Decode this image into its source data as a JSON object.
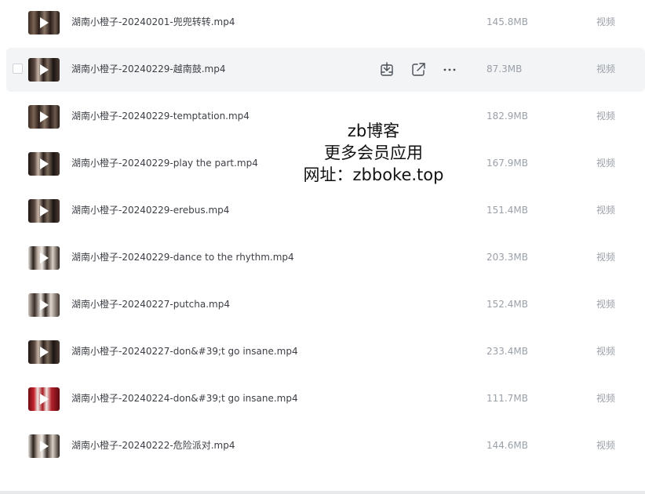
{
  "files": [
    {
      "name": "湖南小橙子-20240201-兜兜转转.mp4",
      "size": "145.8MB",
      "type": "视频",
      "thumb": "v1"
    },
    {
      "name": "湖南小橙子-20240229-越南鼓.mp4",
      "size": "87.3MB",
      "type": "视频",
      "thumb": "v2",
      "hover": true
    },
    {
      "name": "湖南小橙子-20240229-temptation.mp4",
      "size": "182.9MB",
      "type": "视频",
      "thumb": "v1"
    },
    {
      "name": "湖南小橙子-20240229-play the part.mp4",
      "size": "167.9MB",
      "type": "视频",
      "thumb": "v2"
    },
    {
      "name": "湖南小橙子-20240229-erebus.mp4",
      "size": "151.4MB",
      "type": "视频",
      "thumb": "v2"
    },
    {
      "name": "湖南小橙子-20240229-dance to the rhythm.mp4",
      "size": "203.3MB",
      "type": "视频",
      "thumb": "v3"
    },
    {
      "name": "湖南小橙子-20240227-putcha.mp4",
      "size": "152.4MB",
      "type": "视频",
      "thumb": "v5"
    },
    {
      "name": "湖南小橙子-20240227-don&#39;t go insane.mp4",
      "size": "233.4MB",
      "type": "视频",
      "thumb": "v2"
    },
    {
      "name": "湖南小橙子-20240224-don&#39;t go insane.mp4",
      "size": "111.7MB",
      "type": "视频",
      "thumb": "v4"
    },
    {
      "name": "湖南小橙子-20240222-危险派对.mp4",
      "size": "144.6MB",
      "type": "视频",
      "thumb": "v3"
    }
  ],
  "watermark": {
    "line1": "zb博客",
    "line2": "更多会员应用",
    "line3": "网址：zbboke.top"
  },
  "icons": {
    "row_actions": [
      "download-icon",
      "share-icon",
      "more-icon"
    ],
    "thumbnail_overlay": "play-icon"
  }
}
